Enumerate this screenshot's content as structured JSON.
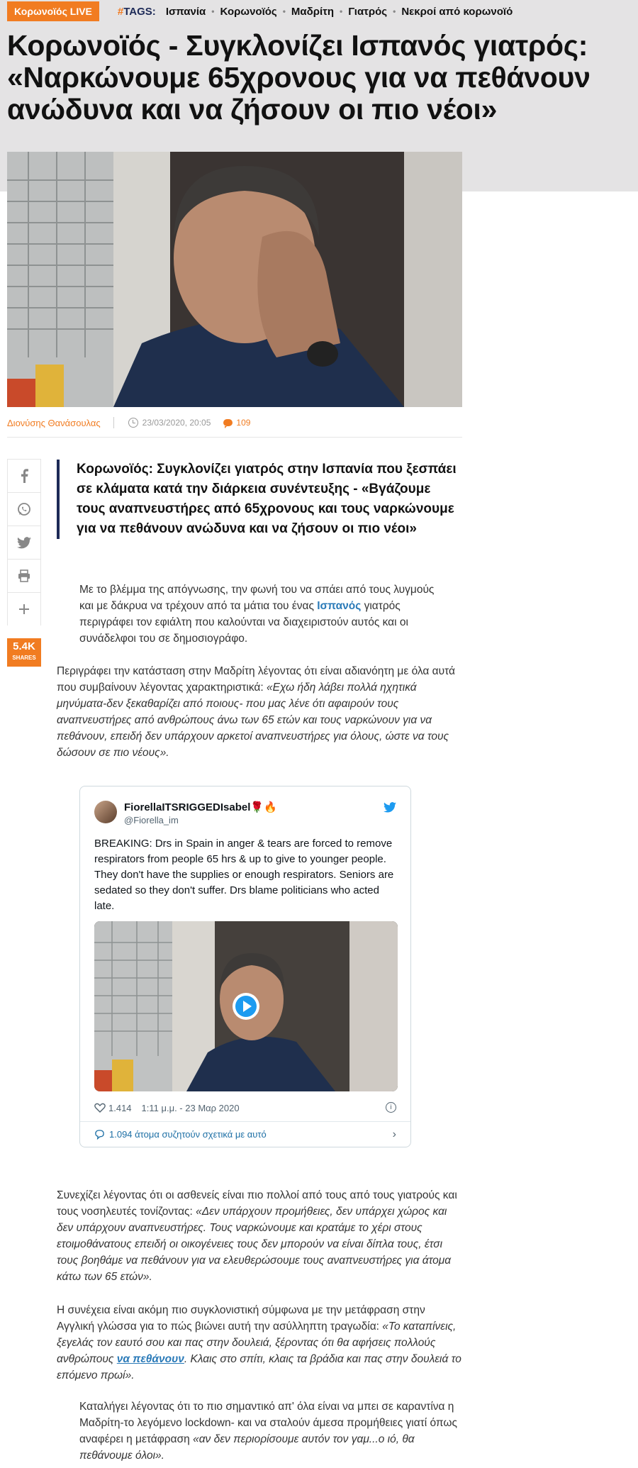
{
  "topbar": {
    "live_label": "Κορωνοϊός LIVE",
    "tags_hash": "#",
    "tags_word": "TAGS:",
    "tags": [
      "Ισπανία",
      "Κορωνοϊός",
      "Μαδρίτη",
      "Γιατρός",
      "Νεκροί από κορωνοϊό"
    ]
  },
  "article": {
    "headline": "Κορωνοϊός - Συγκλονίζει Ισπανός γιατρός: «Ναρκώνουμε 65χρονους για να πεθάνουν ανώδυνα και να ζήσουν οι πιο νέοι»",
    "author": "Διονύσης Θανάσουλας",
    "date": "23/03/2020, 20:05",
    "comments_count": "109",
    "lead": "Κορωνοϊός: Συγκλονίζει γιατρός στην Ισπανία που ξεσπάει σε κλάματα κατά την διάρκεια συνέντευξης - «Βγάζουμε τους αναπνευστήρες από 65χρονους και τους ναρκώνουμε για να πεθάνουν ανώδυνα και να ζήσουν οι πιο νέοι»",
    "p1_before": "Με το βλέμμα της απόγνωσης, την φωνή του να σπάει από τους λυγμούς και με δάκρυα να τρέχουν από τα μάτια του ένας",
    "p1_link": " Ισπανός",
    "p1_after": " γιατρός περιγράφει τον εφιάλτη που καλούνται να διαχειριστούν αυτός και οι συνάδελφοι του σε δημοσιογράφο.",
    "p2_plain": "Περιγράφει την κατάσταση στην Μαδρίτη λέγοντας ότι είναι αδιανόητη με όλα αυτά που συμβαίνουν λέγοντας χαρακτηριστικά: ",
    "p2_quote": "«Εχω ήδη λάβει πολλά ηχητικά μηνύματα-δεν ξεκαθαρίζει από ποιους- που μας λένε ότι αφαιρούν τους αναπνευστήρες από ανθρώπους άνω των 65 ετών και τους ναρκώνουν για να πεθάνουν, επειδή δεν υπάρχουν αρκετοί αναπνευστήρες για όλους, ώστε να τους δώσουν σε πιο νέους».",
    "p3_plain": "Συνεχίζει λέγοντας ότι οι ασθενείς είναι πιο πολλοί από τους από τους γιατρούς και τους νοσηλευτές τονίζοντας: ",
    "p3_quote": "«Δεν υπάρχουν προμήθειες, δεν υπάρχει χώρος και δεν υπάρχουν αναπνευστήρες. Τους ναρκώνουμε και κρατάμε το χέρι στους ετοιμοθάνατους επειδή οι οικογένειες τους δεν μπορούν να είναι δίπλα τους, έτσι τους βοηθάμε να πεθάνουν για να ελευθερώσουμε τους αναπνευστήρες για άτομα κάτω των 65 ετών».",
    "p4_plain": "Η συνέχεια είναι ακόμη πιο συγκλονιστική σύμφωνα με την μετάφραση στην Αγγλική γλώσσα για το πώς βιώνει αυτή την ασύλληπτη τραγωδία: ",
    "p4_quote_a": "«Το καταπίνεις, ξεγελάς τον εαυτό σου και πας στην δουλειά, ξέροντας ότι θα αφήσεις πολλούς ανθρώπους ",
    "p4_link": "να πεθάνουν",
    "p4_quote_b": ". Κλαις στο σπίτι, κλαις τα βράδια και πας στην δουλειά το επόμενο πρωί».",
    "p5_plain": "Καταλήγει λέγοντας ότι το πιο σημαντικό απ' όλα είναι να μπει σε καραντίνα η Μαδρίτη-το λεγόμενο lockdown- και να σταλούν άμεσα προμήθειες γιατί όπως αναφέρει η μετάφραση ",
    "p5_quote": "«αν δεν περιορίσουμε αυτόν τον γαμ...ο ιό, θα πεθάνουμε όλοι»."
  },
  "share": {
    "icons": [
      "facebook-icon",
      "whatsapp-icon",
      "twitter-icon",
      "print-icon",
      "plus-icon"
    ],
    "count": "5.4K",
    "label": "SHARES"
  },
  "tweet": {
    "name": "FiorellaITSRIGGEDIsabel🌹🔥",
    "handle": "@Fiorella_im",
    "text": "BREAKING: Drs in Spain in anger & tears are forced to remove respirators from people 65 hrs & up to give to younger people. They don't have the supplies or enough respirators. Seniors are sedated so they don't suffer. Drs blame politicians who acted late.",
    "likes": "1.414",
    "time": "1:11 μ.μ. - 23 Μαρ 2020",
    "info": "i",
    "discussion": "1.094 άτομα συζητούν σχετικά με αυτό"
  },
  "colors": {
    "accent": "#f17c21",
    "navy": "#1d2a57",
    "link": "#2a7ab8",
    "header_bg": "#e4e3e4"
  }
}
